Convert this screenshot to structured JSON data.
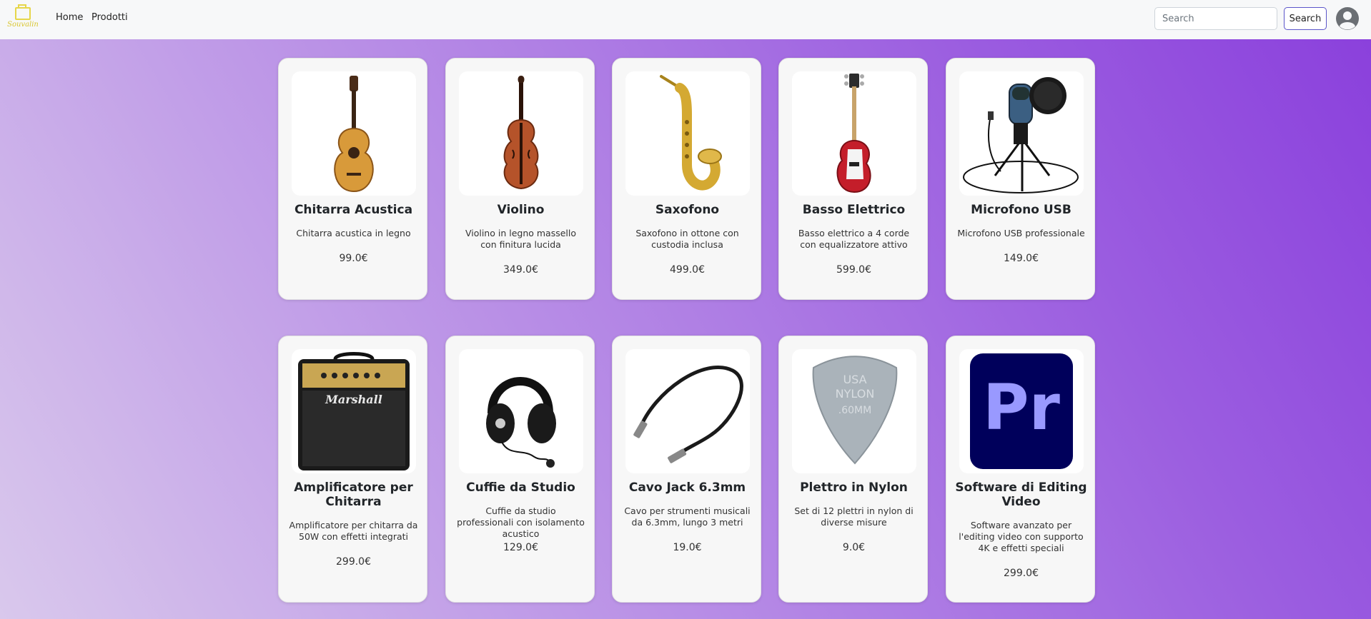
{
  "brand": {
    "name": "Souvalin"
  },
  "nav": {
    "home": "Home",
    "products": "Prodotti"
  },
  "search": {
    "placeholder": "Search",
    "button": "Search"
  },
  "products": [
    {
      "name": "Chitarra Acustica",
      "description": "Chitarra acustica in legno",
      "price": "99.0€",
      "icon": "acoustic-guitar"
    },
    {
      "name": "Violino",
      "description": "Violino in legno massello con finitura lucida",
      "price": "349.0€",
      "icon": "violin"
    },
    {
      "name": "Saxofono",
      "description": "Saxofono in ottone con custodia inclusa",
      "price": "499.0€",
      "icon": "saxophone"
    },
    {
      "name": "Basso Elettrico",
      "description": "Basso elettrico a 4 corde con equalizzatore attivo",
      "price": "599.0€",
      "icon": "bass-guitar"
    },
    {
      "name": "Microfono USB",
      "description": "Microfono USB professionale",
      "price": "149.0€",
      "icon": "usb-microphone"
    },
    {
      "name": "Amplificatore per Chitarra",
      "description": "Amplificatore per chitarra da 50W con effetti integrati",
      "price": "299.0€",
      "icon": "amplifier",
      "logo_text": "Marshall"
    },
    {
      "name": "Cuffie da Studio",
      "description": "Cuffie da studio professionali con isolamento acustico",
      "price": "129.0€",
      "icon": "headphones"
    },
    {
      "name": "Cavo Jack 6.3mm",
      "description": "Cavo per strumenti musicali da 6.3mm, lungo 3 metri",
      "price": "19.0€",
      "icon": "jack-cable"
    },
    {
      "name": "Plettro in Nylon",
      "description": "Set di 12 plettri in nylon di diverse misure",
      "price": "9.0€",
      "icon": "guitar-pick",
      "pick_text": [
        "USA",
        "NYLON",
        ".60MM"
      ]
    },
    {
      "name": "Software di Editing Video",
      "description": "Software avanzato per l'editing video con supporto 4K e effetti speciali",
      "price": "299.0€",
      "icon": "premiere-logo",
      "logo_text": "Pr"
    }
  ]
}
